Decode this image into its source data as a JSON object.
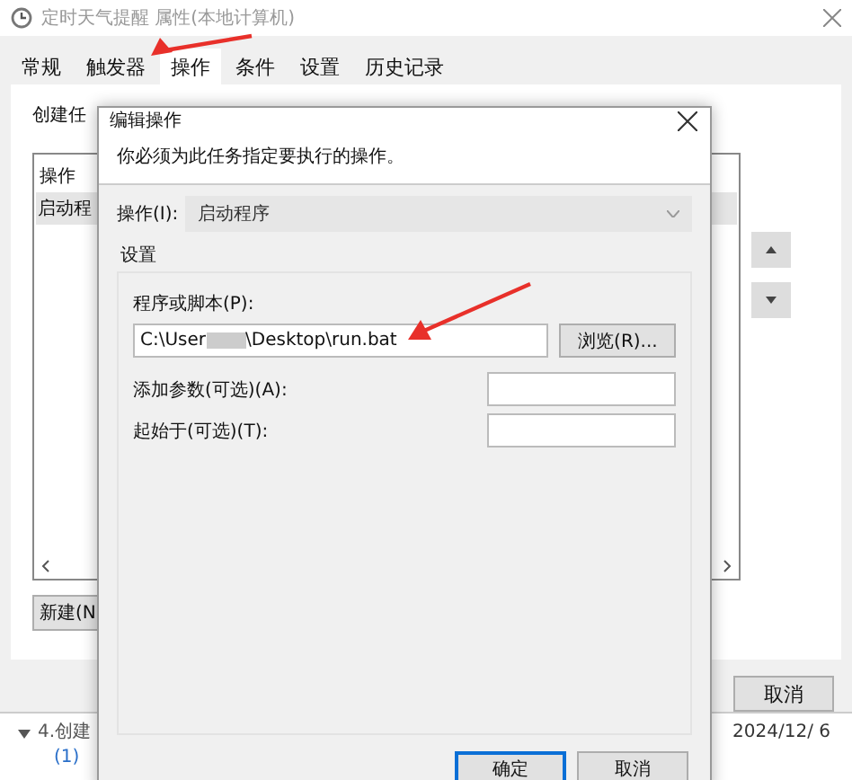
{
  "window": {
    "title": "定时天气提醒 属性(本地计算机)"
  },
  "tabs": [
    {
      "label": "常规",
      "selected": false
    },
    {
      "label": "触发器",
      "selected": false
    },
    {
      "label": "操作",
      "selected": true
    },
    {
      "label": "条件",
      "selected": false
    },
    {
      "label": "设置",
      "selected": false
    },
    {
      "label": "历史记录",
      "selected": false
    }
  ],
  "panel": {
    "intro": "创建任",
    "list": {
      "column": "操作",
      "rows": [
        {
          "cell": "启动程",
          "selected": true
        }
      ]
    },
    "new_button": "新建(N"
  },
  "footer_buttons": [
    "取消"
  ],
  "background_page": {
    "heading": "4.创建",
    "link": "(1)",
    "date": "2024/12/ 6"
  },
  "dialog": {
    "title": "编辑操作",
    "instruction": "你必须为此任务指定要执行的操作。",
    "action": {
      "label": "操作(I):",
      "value": "启动程序",
      "disabled": true
    },
    "group": {
      "title": "设置",
      "program": {
        "label": "程序或脚本(P):",
        "value_start": "C:\\User",
        "value_end": "\\Desktop\\run.bat",
        "browse": "浏览(R)..."
      },
      "arguments": {
        "label": "添加参数(可选)(A):"
      },
      "start_in": {
        "label": "起始于(可选)(T):"
      }
    },
    "buttons": [
      {
        "label": "确定",
        "default": true
      },
      {
        "label": "取消",
        "default": false
      }
    ]
  }
}
